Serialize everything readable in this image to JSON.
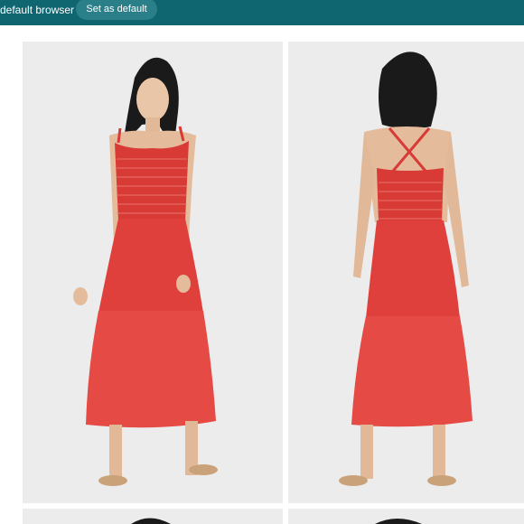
{
  "banner": {
    "message": "default browser",
    "button_label": "Set as default",
    "bg_color": "#0f6670"
  },
  "gallery": {
    "photos": [
      {
        "view": "front",
        "subject": "red tiered midi dress, front view"
      },
      {
        "view": "back",
        "subject": "red tiered midi dress, back view with crossed straps"
      },
      {
        "view": "partial",
        "subject": "next photo row (cut off)"
      },
      {
        "view": "partial",
        "subject": "next photo row (cut off)"
      }
    ],
    "dress_color": "#e0403c"
  }
}
